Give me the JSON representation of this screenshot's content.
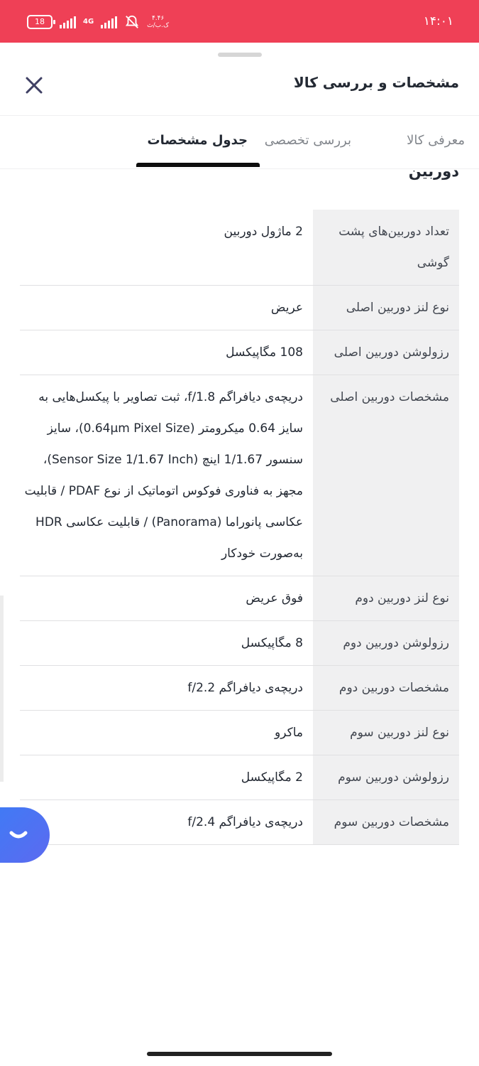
{
  "status_bar": {
    "time": "۱۴:۰۱",
    "battery": "18",
    "network": "4G",
    "speed_value": "۴.۴۶",
    "speed_unit": "ک.ب/ث"
  },
  "header": {
    "title": "مشخصات و بررسی کالا"
  },
  "tabs": [
    {
      "label": "معرفی کالا"
    },
    {
      "label": "بررسی تخصصی"
    },
    {
      "label": "جدول مشخصات",
      "active": true
    }
  ],
  "section": {
    "title": "دوربین"
  },
  "specs": [
    {
      "key": "تعداد دوربین‌های پشت گوشی",
      "value": "2 ماژول دوربین"
    },
    {
      "key": "نوع لنز دوربین اصلی",
      "value": "عریض"
    },
    {
      "key": "رزولوشن دوربین اصلی",
      "value": "108 مگاپیکسل"
    },
    {
      "key": "مشخصات دوربین اصلی",
      "value": "دریچه‌ی دیافراگم f/1.8، ثبت تصاویر با پیکسل‌هایی به سایز 0.64 میکرومتر (0.64µm Pixel Size)، سایز سنسور 1/1.67 اینچ (Sensor Size 1/1.67 Inch)، مجهز به فناوری فوکوس اتوماتیک از نوع PDAF / قابلیت عکاسی پانوراما (Panorama) / قابلیت عکاسی HDR به‌صورت خودکار"
    },
    {
      "key": "نوع لنز دوربین دوم",
      "value": "فوق عریض"
    },
    {
      "key": "رزولوشن دوربین دوم",
      "value": "8 مگاپیکسل"
    },
    {
      "key": "مشخصات دوربین دوم",
      "value": "دریچه‌ی دیافراگم f/2.2"
    },
    {
      "key": "نوع لنز دوربین سوم",
      "value": "ماکرو"
    },
    {
      "key": "رزولوشن دوربین سوم",
      "value": "2 مگاپیکسل"
    },
    {
      "key": "مشخصات دوربین سوم",
      "value": "دریچه‌ی دیافراگم f/2.4"
    }
  ],
  "colors": {
    "status_bar": "#ef4056",
    "chat_button": "#4a74f3"
  },
  "icons": {
    "close": "close-icon",
    "chat": "chat-icon",
    "notifications_off": "bell-off-icon"
  }
}
